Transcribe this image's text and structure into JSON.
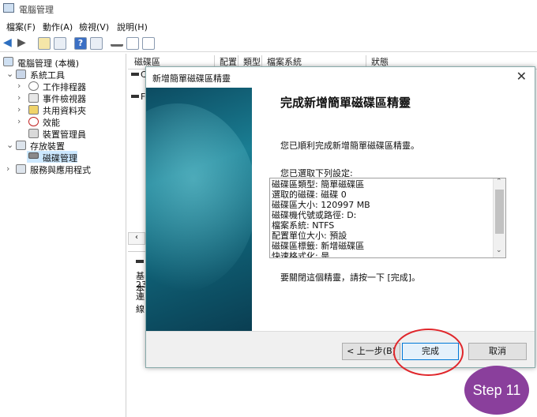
{
  "app": {
    "title": "電腦管理"
  },
  "menu": [
    "檔案(F)",
    "動作(A)",
    "檢視(V)",
    "說明(H)"
  ],
  "tree": {
    "root": "電腦管理 (本機)",
    "system_tools": "系統工具",
    "task_scheduler": "工作排程器",
    "event_viewer": "事件檢視器",
    "shared_folders": "共用資料夾",
    "performance": "效能",
    "device_manager": "裝置管理員",
    "storage": "存放裝置",
    "disk_management": "磁碟管理",
    "services_apps": "服務與應用程式"
  },
  "columns": [
    "磁碟區",
    "配置",
    "類型",
    "檔案系統",
    "狀態"
  ],
  "volume_letters": [
    "C",
    "F"
  ],
  "disk_panel": {
    "line1": "基本",
    "line2": "23",
    "line3": "連線"
  },
  "wizard": {
    "window_title": "新增簡單磁碟區精靈",
    "heading": "完成新增簡單磁碟區精靈",
    "intro": "您已順利完成新增簡單磁碟區精靈。",
    "selected_label": "您已選取下列設定:",
    "settings": [
      "磁碟區類型: 簡單磁碟區",
      "選取的磁碟: 磁碟 0",
      "磁碟區大小: 120997 MB",
      "磁碟機代號或路徑: D:",
      "檔案系統: NTFS",
      "配置單位大小: 預設",
      "磁碟區標籤: 新增磁碟區",
      "快速格式化: 是"
    ],
    "close_instruction": "要關閉這個精靈，請按一下 [完成]。",
    "back_label": "< 上一步(B)",
    "finish_label": "完成",
    "cancel_label": "取消"
  },
  "badge": {
    "text": "Step 11",
    "color": "#8a3f9c"
  },
  "highlight_color": "#e0262b"
}
